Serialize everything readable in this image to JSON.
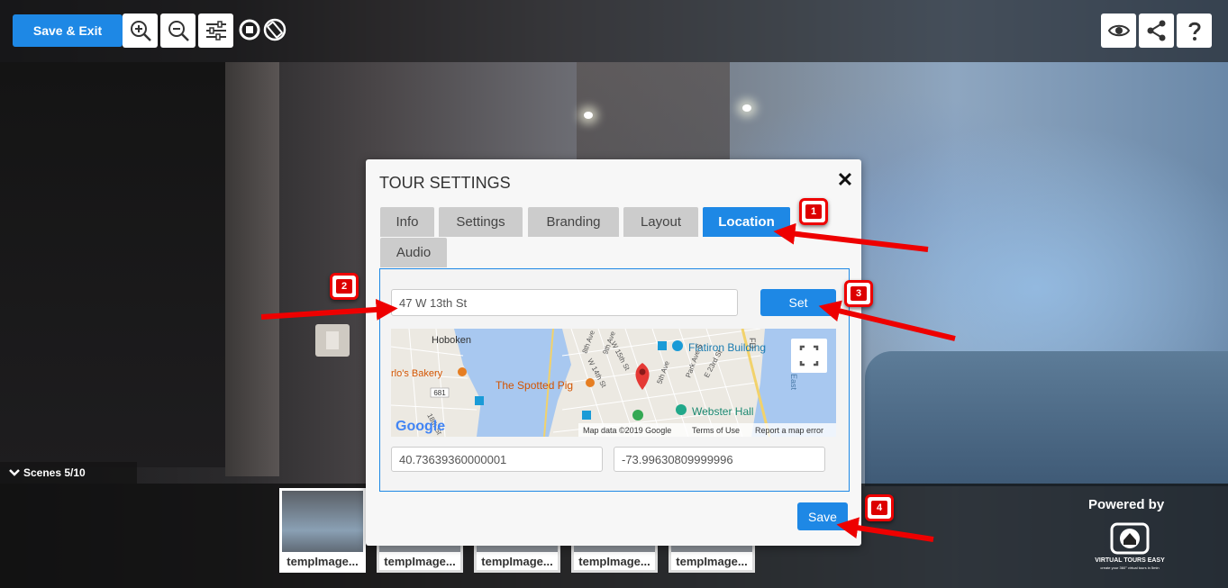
{
  "toolbar": {
    "save_exit_label": "Save & Exit",
    "left_icons": [
      "zoom-in-icon",
      "zoom-out-icon",
      "sliders-icon",
      "stop-icon",
      "rotate-icon"
    ],
    "right_icons": [
      "eye-icon",
      "share-icon",
      "help-icon"
    ]
  },
  "modal": {
    "title": "TOUR SETTINGS",
    "close_glyph": "✕",
    "tabs": [
      {
        "label": "Info",
        "active": false
      },
      {
        "label": "Settings",
        "active": false
      },
      {
        "label": "Branding",
        "active": false
      },
      {
        "label": "Layout",
        "active": false
      },
      {
        "label": "Location",
        "active": true
      },
      {
        "label": "Audio",
        "active": false
      }
    ],
    "location": {
      "address_value": "47 W 13th St",
      "set_label": "Set",
      "latitude": "40.73639360000001",
      "longitude": "-73.99630809999996",
      "map_labels": {
        "hoboken": "Hoboken",
        "bakery": "rlo's Bakery",
        "spotted_pig": "The Spotted Pig",
        "flatiron": "Flatiron Building",
        "webster": "Webster Hall",
        "w14": "W 14th St",
        "w15": "W 15th St",
        "ave8": "8th Ave",
        "ave9": "9th Ave",
        "ave5": "5th Ave",
        "park": "Park Ave S",
        "e23": "E 23rd St",
        "st18": "18th St",
        "fd": "FD",
        "east": "East",
        "hwy": "681",
        "google": "Google",
        "map_data": "Map data ©2019 Google",
        "terms": "Terms of Use",
        "report": "Report a map error"
      }
    },
    "save_label": "Save"
  },
  "scenes": {
    "toggle_label": "Scenes 5/10",
    "thumbnails": [
      {
        "label": "tempImage..."
      },
      {
        "label": "tempImage..."
      },
      {
        "label": "tempImage..."
      },
      {
        "label": "tempImage..."
      },
      {
        "label": "tempImage..."
      }
    ]
  },
  "branding": {
    "powered_by": "Powered by",
    "logo_name": "VIRTUAL TOURS EASY",
    "logo_tagline": "create your 360° virtual tours in 5min"
  },
  "callouts": [
    "1",
    "2",
    "3",
    "4"
  ],
  "colors": {
    "accent": "#1e88e5",
    "callout_red": "#e00000"
  }
}
